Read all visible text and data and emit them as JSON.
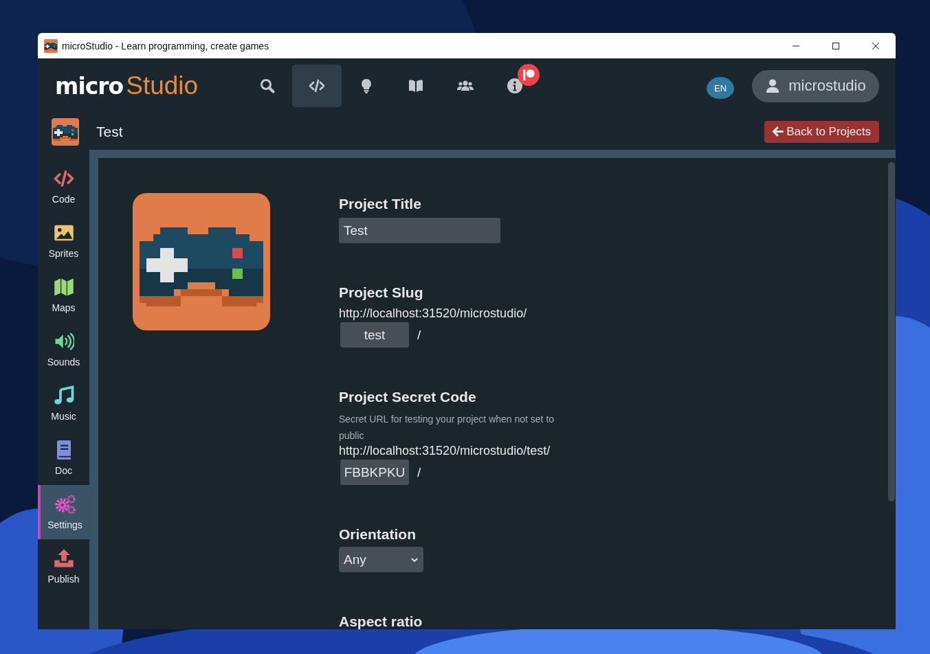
{
  "window": {
    "title": "microStudio - Learn programming, create games"
  },
  "header": {
    "logo": {
      "bold": "micro",
      "light": "Studio"
    },
    "nav": [
      {
        "kind": "search",
        "selected": false
      },
      {
        "kind": "code",
        "selected": true
      },
      {
        "kind": "tutorials",
        "selected": false
      },
      {
        "kind": "docs",
        "selected": false
      },
      {
        "kind": "community",
        "selected": false
      },
      {
        "kind": "about",
        "selected": false,
        "badge": true
      }
    ],
    "language": "EN",
    "user": "microstudio"
  },
  "project": {
    "title": "Test",
    "back_button": "Back to Projects"
  },
  "sidebar": [
    {
      "kind": "code",
      "label": "Code",
      "color": "#e0676a",
      "selected": false
    },
    {
      "kind": "sprites",
      "label": "Sprites",
      "color": "#e8c46a",
      "selected": false
    },
    {
      "kind": "maps",
      "label": "Maps",
      "color": "#9bd878",
      "selected": false
    },
    {
      "kind": "sounds",
      "label": "Sounds",
      "color": "#6cd69a",
      "selected": false
    },
    {
      "kind": "music",
      "label": "Music",
      "color": "#6cd8d8",
      "selected": false
    },
    {
      "kind": "doc",
      "label": "Doc",
      "color": "#7f8fe0",
      "selected": false
    },
    {
      "kind": "settings",
      "label": "Settings",
      "color": "#ec52c8",
      "selected": true
    },
    {
      "kind": "publish",
      "label": "Publish",
      "color": "#e0676a",
      "selected": false
    }
  ],
  "settings": {
    "project_title": {
      "label": "Project Title",
      "value": "Test"
    },
    "slug": {
      "label": "Project Slug",
      "url": "http://localhost:31520/microstudio/",
      "value": "test",
      "suffix": "/"
    },
    "secret": {
      "label": "Project Secret Code",
      "description": "Secret URL for testing your project when not set to public",
      "url": "http://localhost:31520/microstudio/test/",
      "value": "FBBKPKU",
      "suffix": "/"
    },
    "orientation": {
      "label": "Orientation",
      "value": "Any"
    },
    "aspect_ratio": {
      "label": "Aspect ratio"
    }
  }
}
